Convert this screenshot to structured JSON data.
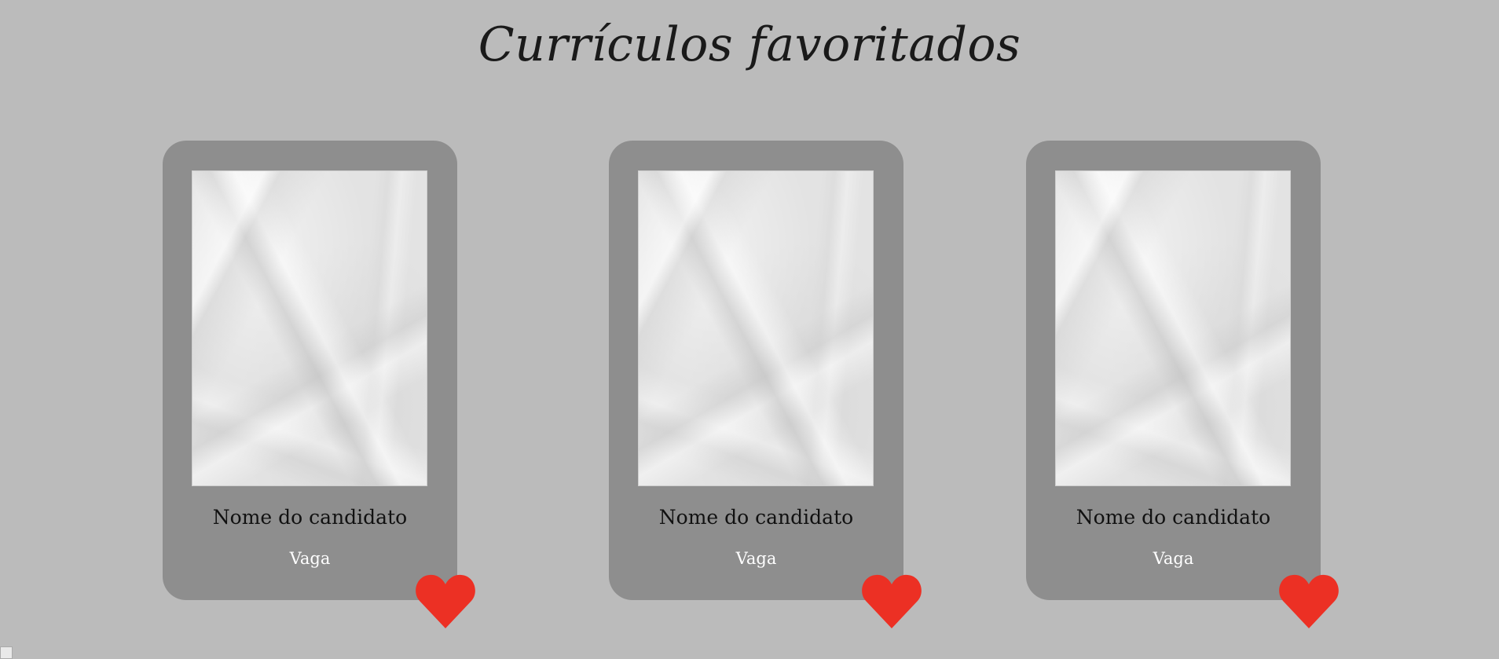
{
  "header": {
    "title": "Currículos favoritados"
  },
  "cards": [
    {
      "name": "Nome do candidato",
      "job": "Vaga",
      "favorited": true
    },
    {
      "name": "Nome do candidato",
      "job": "Vaga",
      "favorited": true
    },
    {
      "name": "Nome do candidato",
      "job": "Vaga",
      "favorited": true
    }
  ],
  "icons": {
    "favorite": "heart-icon"
  },
  "colors": {
    "background": "#bbbbbb",
    "card": "#8e8e8e",
    "heart": "#ec3024",
    "name_text": "#111111",
    "job_text": "#ffffff"
  }
}
